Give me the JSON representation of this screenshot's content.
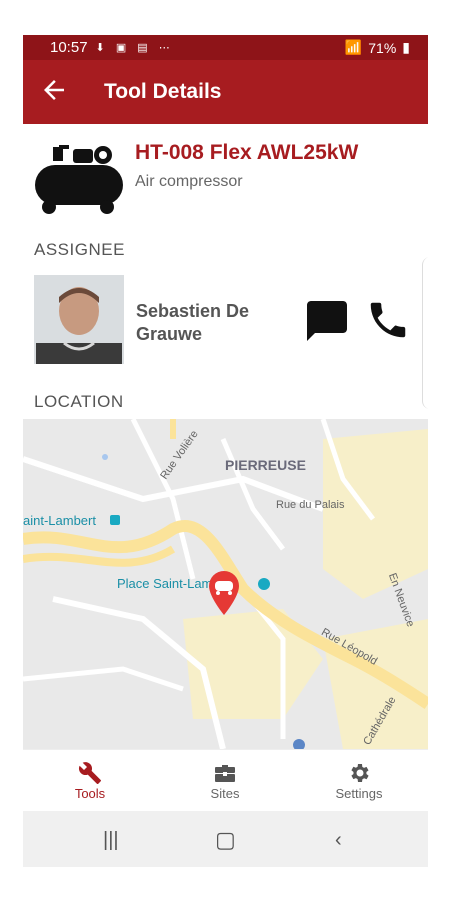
{
  "status": {
    "time": "10:57",
    "battery": "71%"
  },
  "appbar": {
    "title": "Tool Details"
  },
  "tool": {
    "name": "HT-008 Flex AWL25kW",
    "type": "Air compressor"
  },
  "assignee": {
    "section_label": "ASSIGNEE",
    "name": "Sebastien De Grauwe"
  },
  "location": {
    "section_label": "LOCATION"
  },
  "map": {
    "labels": {
      "rue_voliere": "Rue Volière",
      "pierreuse": "PIERREUSE",
      "rue_du_palais": "Rue du Palais",
      "saint_lambert": "aint-Lambert",
      "place_saint_lambert": "Place Saint-Lambert",
      "en_neuvice": "En Neuvice",
      "rue_leopold": "Rue Léopold",
      "cathedrale": "Cathédrale"
    },
    "colors": {
      "base": "#e9e9e9",
      "road_major": "#fbe9a6",
      "road": "#ffffff",
      "pin": "#e53935"
    }
  },
  "nav": {
    "items": [
      {
        "label": "Tools",
        "icon": "wrench-icon",
        "active": true
      },
      {
        "label": "Sites",
        "icon": "toolbox-icon",
        "active": false
      },
      {
        "label": "Settings",
        "icon": "gear-icon",
        "active": false
      }
    ]
  },
  "colors": {
    "primary": "#a71c20",
    "status_bar": "#8e1418"
  }
}
